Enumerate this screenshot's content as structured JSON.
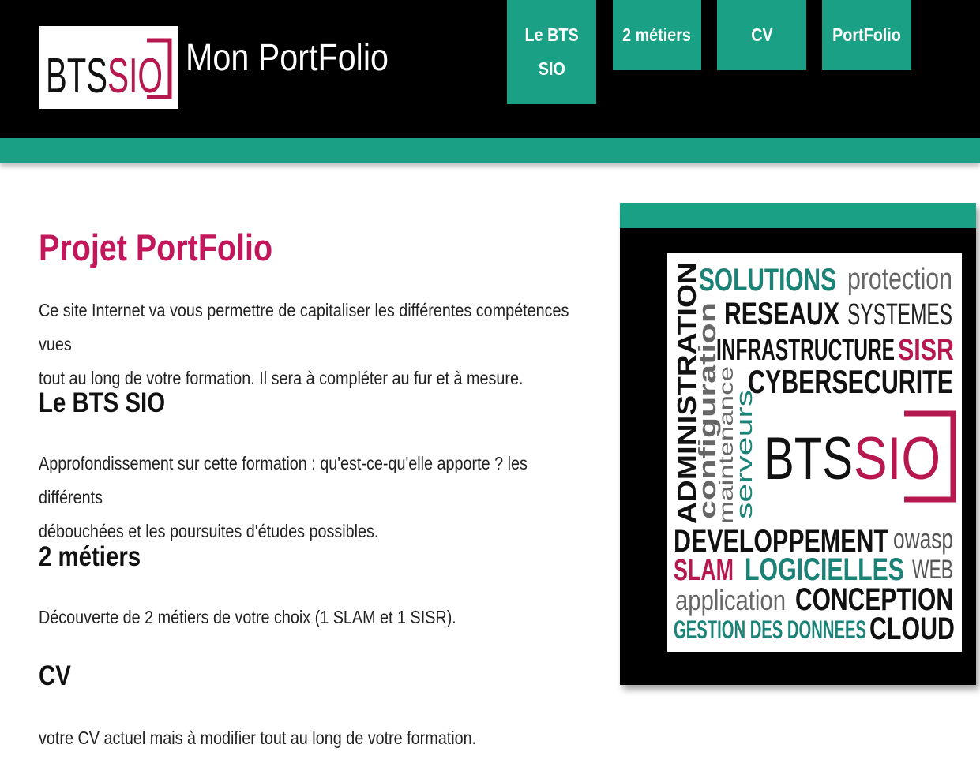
{
  "header": {
    "logo_text": "BTSSIO",
    "site_title": "Mon PortFolio"
  },
  "nav": [
    {
      "label_line1": "Le BTS",
      "label_line2": "SIO"
    },
    {
      "label_line1": "2 métiers"
    },
    {
      "label_line1": "CV"
    },
    {
      "label_line1": "PortFolio"
    }
  ],
  "main": {
    "title": "Projet PortFolio",
    "intro_line1": "Ce site Internet va vous permettre de capitaliser les différentes compétences vues",
    "intro_line2": "tout au long de votre formation. Il sera à compléter au fur et à mesure.",
    "section1_heading": "Le BTS SIO",
    "section1_line1": "Approfondissement sur cette formation : qu'est-ce-qu'elle apporte ? les différents",
    "section1_line2": "débouchées et les poursuites d'études possibles.",
    "section2_heading": "2 métiers",
    "section2_text": "Découverte de 2 métiers de votre choix (1 SLAM et 1 SISR).",
    "section3_heading": "CV",
    "section3_text": "votre CV actuel mais à modifier tout au long de votre formation."
  },
  "wordcloud": {
    "words": {
      "solutions": "SOLUTIONS",
      "protection": "protection",
      "reseaux": "RESEAUX",
      "systemes": "SYSTEMES",
      "infrastructure": "INFRASTRUCTURE",
      "sisr": "SISR",
      "cybersecurite": "CYBERSECURITE",
      "administration": "ADMINISTRATION",
      "configuration": "configuration",
      "maintenance": "maintenance",
      "serveurs": "serveurs",
      "bts": "BTS",
      "sio": "SIO",
      "developpement": "DEVELOPPEMENT",
      "owasp": "owasp",
      "slam": "SLAM",
      "logicielles": "LOGICIELLES",
      "web": "WEB",
      "application": "application",
      "conception": "CONCEPTION",
      "gestion": "GESTION DES DONNEES",
      "cloud": "CLOUD"
    }
  },
  "colors": {
    "teal": "#1aa185",
    "crimson": "#c2185b",
    "black": "#000000",
    "wordcloud_teal": "#1a8276",
    "wordcloud_gray": "#555555",
    "wordcloud_red": "#b5174e"
  }
}
